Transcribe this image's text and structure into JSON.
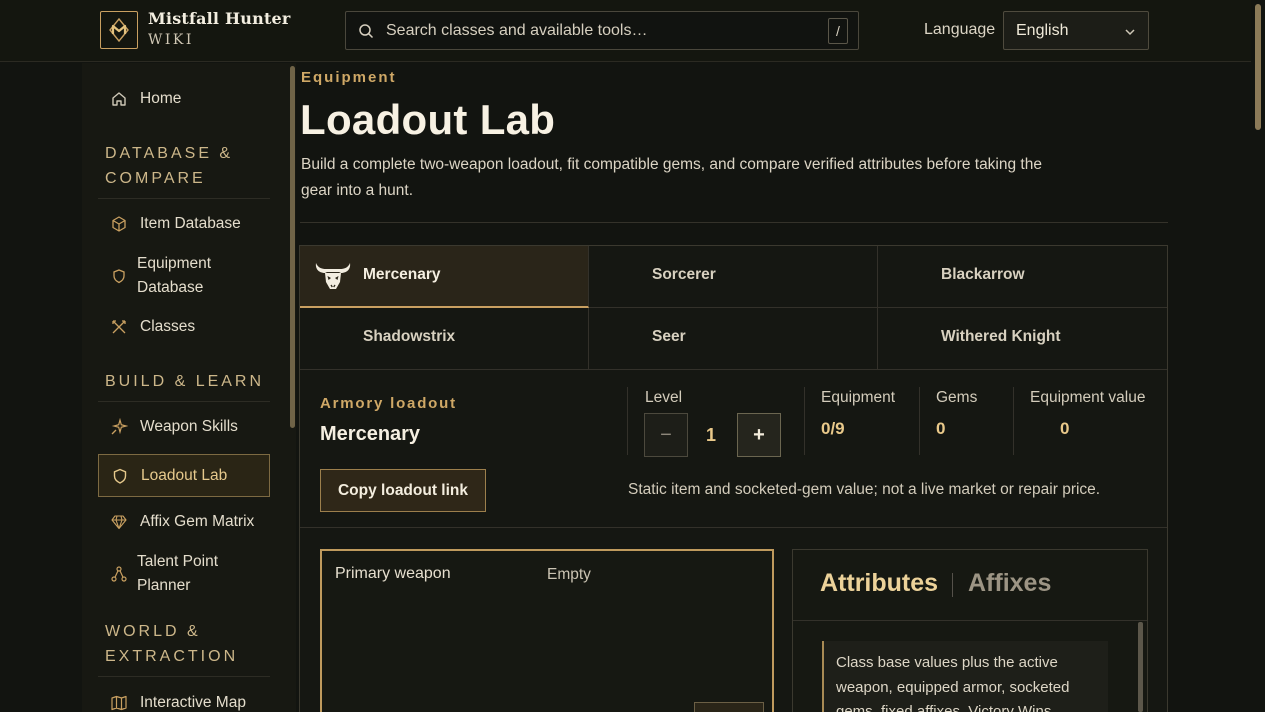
{
  "header": {
    "brand_title": "Mistfall Hunter",
    "brand_subtitle": "WIKI",
    "search_placeholder": "Search classes and available tools…",
    "search_shortcut": "/",
    "language_label": "Language",
    "language_value": "English"
  },
  "sidebar": {
    "home": "Home",
    "sections": [
      {
        "title": "DATABASE & COMPARE",
        "items": [
          "Item Database",
          "Equipment Database",
          "Classes"
        ]
      },
      {
        "title": "BUILD & LEARN",
        "items": [
          "Weapon Skills",
          "Loadout Lab",
          "Affix Gem Matrix",
          "Talent Point Planner"
        ]
      },
      {
        "title": "WORLD & EXTRACTION",
        "items": [
          "Interactive Map"
        ]
      }
    ],
    "active_item": "Loadout Lab"
  },
  "page": {
    "eyebrow": "Equipment",
    "title": "Loadout Lab",
    "lead": "Build a complete two-weapon loadout, fit compatible gems, and compare verified attributes before taking the gear into a hunt."
  },
  "classes": [
    "Mercenary",
    "Sorcerer",
    "Blackarrow",
    "Shadowstrix",
    "Seer",
    "Withered Knight"
  ],
  "selected_class": "Mercenary",
  "loadout": {
    "label": "Armory loadout",
    "name": "Mercenary",
    "copy_button": "Copy loadout link",
    "level_label": "Level",
    "level_minus": "−",
    "level_value": "1",
    "level_plus": "+",
    "equipment_label": "Equipment",
    "equipment_value": "0/9",
    "gems_label": "Gems",
    "gems_value": "0",
    "equipment_value_label": "Equipment value",
    "equipment_value_value": "0",
    "note": "Static item and socketed-gem value; not a live market or repair price."
  },
  "slots": {
    "primary_label": "Primary weapon",
    "primary_value": "Empty"
  },
  "attributes": {
    "tab_attributes": "Attributes",
    "tab_affixes": "Affixes",
    "note": "Class base values plus the active weapon, equipped armor, socketed gems, fixed affixes, Victory Wins"
  },
  "colors": {
    "accent_gold": "#c9a061",
    "background": "#121410"
  }
}
